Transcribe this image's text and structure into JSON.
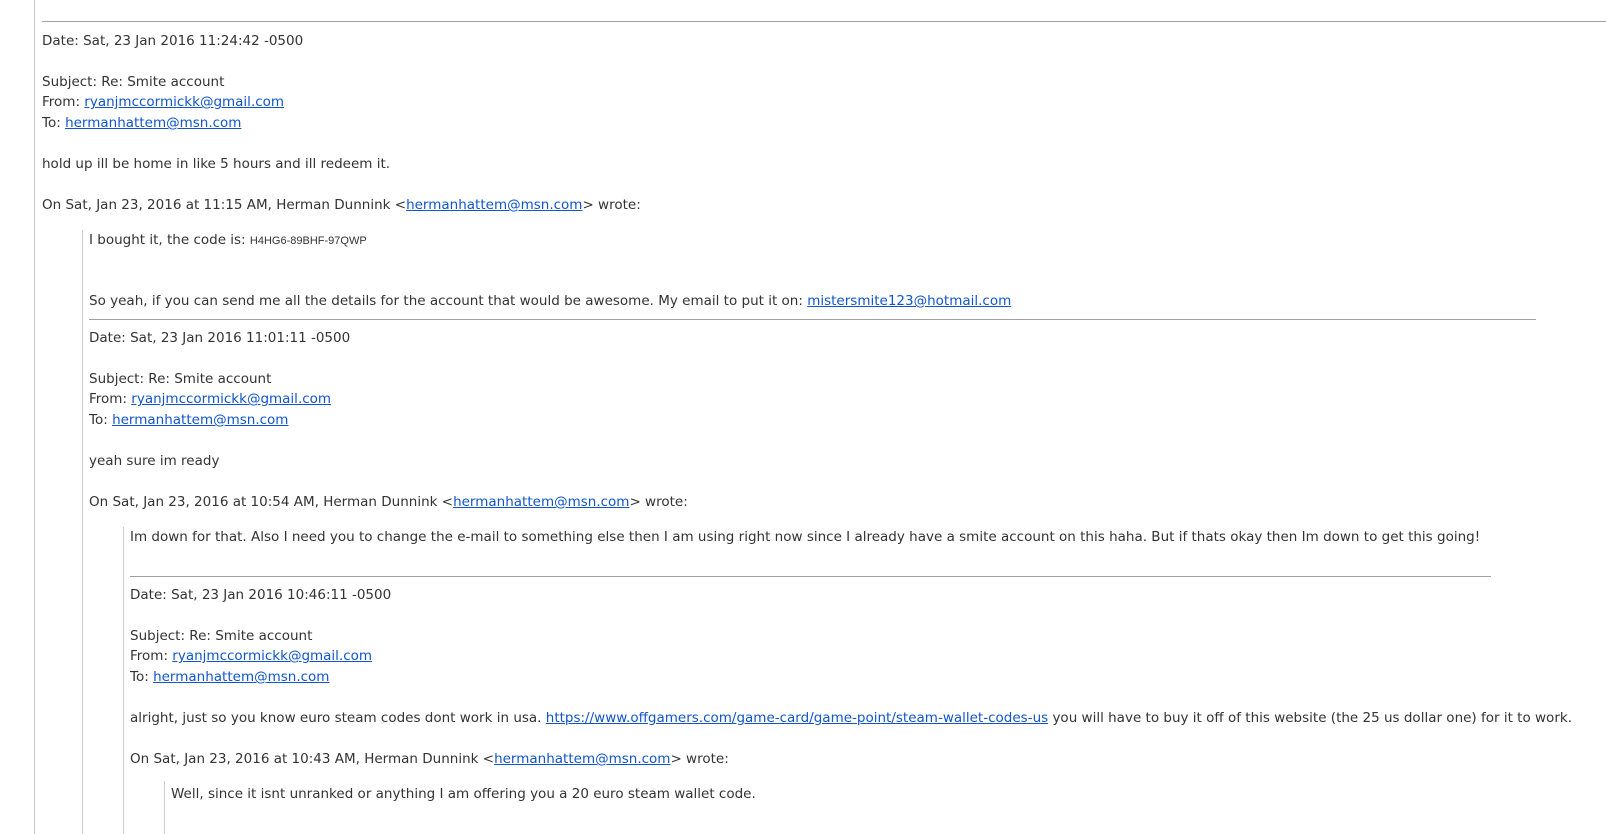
{
  "top_message": {
    "date": "Date: Sat, 23 Jan 2016 11:24:42 -0500",
    "subject": "Subject: Re: Smite account",
    "from_label": "From: ",
    "from_email": "ryanjmccormickk@gmail.com",
    "to_label": "To: ",
    "to_email": "hermanhattem@msn.com",
    "body": "hold up ill be home in like 5 hours and ill redeem it.",
    "attribution_prefix": "On Sat, Jan 23, 2016 at 11:15 AM, Herman Dunnink <",
    "attribution_email": "hermanhattem@msn.com",
    "attribution_suffix": "> wrote:"
  },
  "quote1": {
    "body_prefix": "I bought it, the code is: ",
    "code": "H4HG6-89BHF-97QWP",
    "body2_prefix": "So yeah, if you can send me all the details for the account that would be awesome. My email to put it on: ",
    "body2_email": "mistersmite123@hotmail.com",
    "date": "Date: Sat, 23 Jan 2016 11:01:11 -0500",
    "subject": "Subject: Re: Smite account",
    "from_label": "From: ",
    "from_email": "ryanjmccormickk@gmail.com",
    "to_label": "To: ",
    "to_email": "hermanhattem@msn.com",
    "body3": "yeah sure im ready",
    "attribution_prefix": "On Sat, Jan 23, 2016 at 10:54 AM, Herman Dunnink <",
    "attribution_email": "hermanhattem@msn.com",
    "attribution_suffix": "> wrote:"
  },
  "quote2": {
    "body": "Im down for that. Also I need you to change the e-mail to something else then I am using right now since I already have a smite account on this haha. But if thats okay then Im down to get this going!",
    "date": "Date: Sat, 23 Jan 2016 10:46:11 -0500",
    "subject": "Subject: Re: Smite account",
    "from_label": "From: ",
    "from_email": "ryanjmccormickk@gmail.com",
    "to_label": "To: ",
    "to_email": "hermanhattem@msn.com",
    "body2_prefix": "alright, just so you know euro steam codes dont work in usa. ",
    "body2_link": "https://www.offgamers.com/game-card/game-point/steam-wallet-codes-us",
    "body2_suffix": " you will have to buy it off of this website (the 25 us dollar one) for it to work.",
    "attribution_prefix": "On Sat, Jan 23, 2016 at 10:43 AM, Herman Dunnink <",
    "attribution_email": "hermanhattem@msn.com",
    "attribution_suffix": "> wrote:"
  },
  "quote3": {
    "body": "Well, since it isnt unranked or anything I am offering you a 20 euro steam wallet code."
  }
}
